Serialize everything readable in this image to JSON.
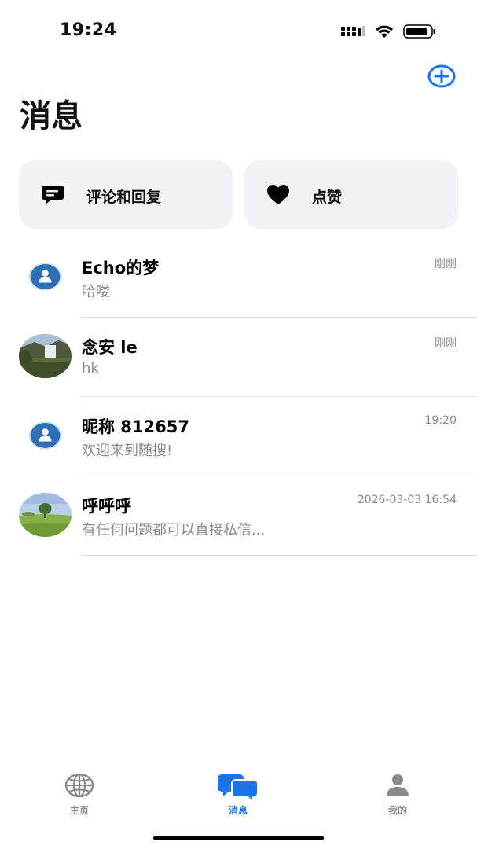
{
  "status_bar": {
    "time": "19:24"
  },
  "header": {
    "title": "消息",
    "add_icon": "plus-circle-icon"
  },
  "quick_cards": [
    {
      "label": "评论和回复",
      "icon": "comment-icon"
    },
    {
      "label": "点赞",
      "icon": "heart-icon"
    }
  ],
  "conversations": [
    {
      "name": "Echo的梦",
      "message": "哈喽",
      "time": "刚刚",
      "avatar": "default-user-avatar"
    },
    {
      "name": "念安 le",
      "message": "hk",
      "time": "刚刚",
      "avatar": "waterfall-photo-avatar"
    },
    {
      "name": "昵称 812657",
      "message": "欢迎来到随搜!",
      "time": "19:20",
      "avatar": "default-user-avatar"
    },
    {
      "name": "呼呼呼",
      "message": "有任何问题都可以直接私信...",
      "time": "2026-03-03 16:54",
      "avatar": "tree-landscape-avatar"
    }
  ],
  "tabs": [
    {
      "label": "主页",
      "icon": "globe-icon",
      "active": false
    },
    {
      "label": "消息",
      "icon": "chat-bubbles-icon",
      "active": true
    },
    {
      "label": "我的",
      "icon": "person-icon",
      "active": false
    }
  ],
  "colors": {
    "accent": "#1a73e8",
    "card_bg": "#f2f2f4",
    "secondary_text": "#8a8a8e",
    "avatar_blue": "#2f6fb8"
  }
}
